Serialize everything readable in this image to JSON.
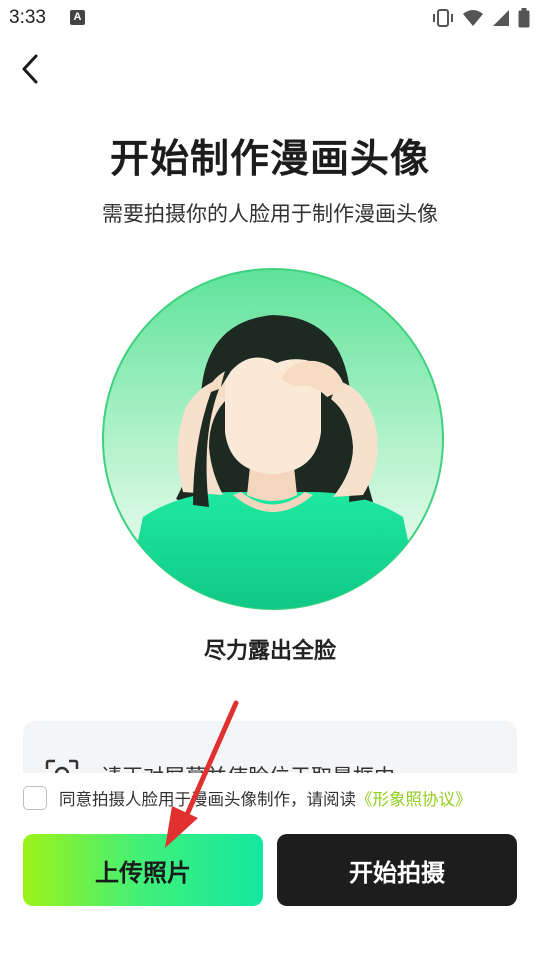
{
  "status_bar": {
    "time": "3:33",
    "notification_letter": "A",
    "icons": [
      "vibrate-icon",
      "wifi-icon",
      "signal-icon",
      "battery-icon"
    ]
  },
  "nav": {
    "back_icon": "chevron-left-icon"
  },
  "title": "开始制作漫画头像",
  "subtitle": "需要拍摄你的人脸用于制作漫画头像",
  "illustration": {
    "icon": "face-portrait-illustration",
    "accent_color": "#5ee39a"
  },
  "hint": "尽力露出全脸",
  "tips": {
    "icon": "face-frame-icon",
    "text": "请正对屏幕并使脸位于取景框中"
  },
  "agreement": {
    "text": "同意拍摄人脸用于漫画头像制作，请阅读",
    "link": "《形象照协议》",
    "checked": false
  },
  "buttons": {
    "upload": "上传照片",
    "shoot": "开始拍摄"
  },
  "colors": {
    "brand_green": "#3ff07a",
    "link_green": "#8fcf1f",
    "dark_button": "#1d1d1d",
    "annotation_arrow": "#e03030"
  }
}
